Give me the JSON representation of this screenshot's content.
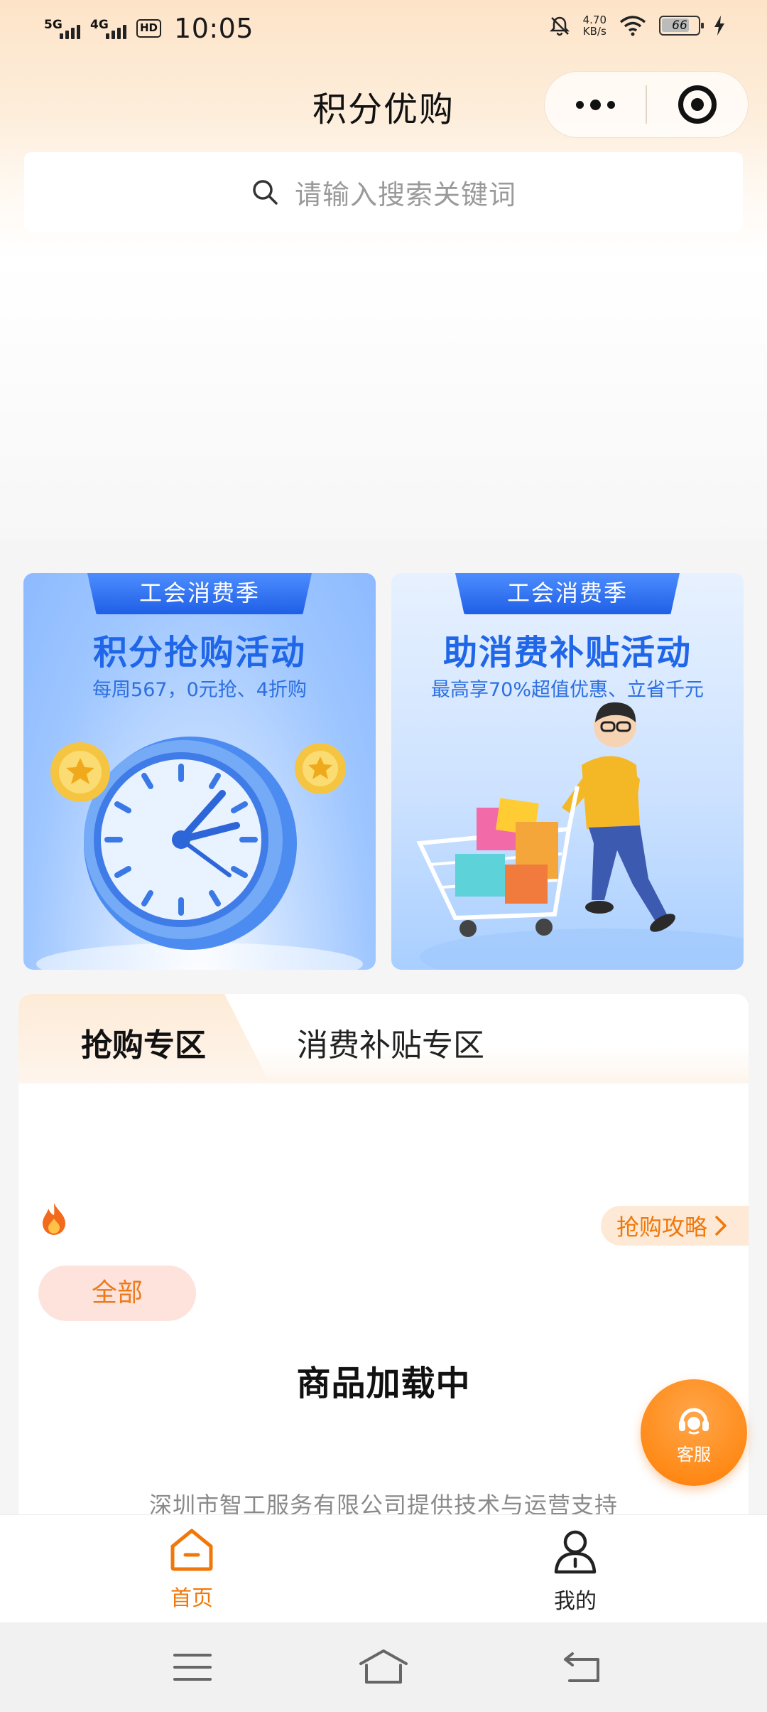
{
  "status_bar": {
    "net1": "5G",
    "net2": "4G",
    "hd": "HD",
    "time": "10:05",
    "speed_value": "4.70",
    "speed_unit": "KB/s",
    "battery": "66"
  },
  "header": {
    "title": "积分优购"
  },
  "search": {
    "placeholder": "请输入搜索关键词"
  },
  "banners": [
    {
      "tag": "工会消费季",
      "title": "积分抢购活动",
      "subtitle": "每周567，0元抢、4折购"
    },
    {
      "tag": "工会消费季",
      "title": "助消费补贴活动",
      "subtitle": "最高享70%超值优惠、立省千元"
    }
  ],
  "tabs": [
    {
      "label": "抢购专区",
      "active": true
    },
    {
      "label": "消费补贴专区",
      "active": false
    }
  ],
  "guide_label": "抢购攻略",
  "filter_chip": "全部",
  "loading_text": "商品加载中",
  "footer_note": "深圳市智工服务有限公司提供技术与运营支持",
  "service_label": "客服",
  "bottom_nav": {
    "home": "首页",
    "mine": "我的"
  },
  "colors": {
    "accent": "#f0780a",
    "banner_blue": "#1f66e8"
  }
}
